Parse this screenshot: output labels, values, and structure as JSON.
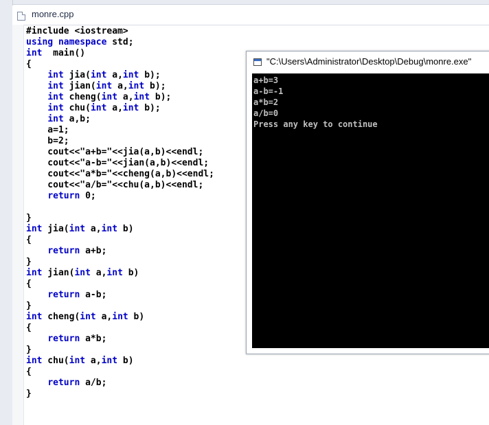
{
  "editor": {
    "file_name": "monre.cpp",
    "code_lines": [
      [
        {
          "t": "#include <iostream>",
          "k": false
        }
      ],
      [
        {
          "t": "using namespace",
          "k": true
        },
        {
          "t": " std;",
          "k": false
        }
      ],
      [
        {
          "t": "int",
          "k": true
        },
        {
          "t": "  main()",
          "k": false
        }
      ],
      [
        {
          "t": "{",
          "k": false
        }
      ],
      [
        {
          "t": "    ",
          "k": false
        },
        {
          "t": "int",
          "k": true
        },
        {
          "t": " jia(",
          "k": false
        },
        {
          "t": "int",
          "k": true
        },
        {
          "t": " a,",
          "k": false
        },
        {
          "t": "int",
          "k": true
        },
        {
          "t": " b);",
          "k": false
        }
      ],
      [
        {
          "t": "    ",
          "k": false
        },
        {
          "t": "int",
          "k": true
        },
        {
          "t": " jian(",
          "k": false
        },
        {
          "t": "int",
          "k": true
        },
        {
          "t": " a,",
          "k": false
        },
        {
          "t": "int",
          "k": true
        },
        {
          "t": " b);",
          "k": false
        }
      ],
      [
        {
          "t": "    ",
          "k": false
        },
        {
          "t": "int",
          "k": true
        },
        {
          "t": " cheng(",
          "k": false
        },
        {
          "t": "int",
          "k": true
        },
        {
          "t": " a,",
          "k": false
        },
        {
          "t": "int",
          "k": true
        },
        {
          "t": " b);",
          "k": false
        }
      ],
      [
        {
          "t": "    ",
          "k": false
        },
        {
          "t": "int",
          "k": true
        },
        {
          "t": " chu(",
          "k": false
        },
        {
          "t": "int",
          "k": true
        },
        {
          "t": " a,",
          "k": false
        },
        {
          "t": "int",
          "k": true
        },
        {
          "t": " b);",
          "k": false
        }
      ],
      [
        {
          "t": "    ",
          "k": false
        },
        {
          "t": "int",
          "k": true
        },
        {
          "t": " a,b;",
          "k": false
        }
      ],
      [
        {
          "t": "    a=1;",
          "k": false
        }
      ],
      [
        {
          "t": "    b=2;",
          "k": false
        }
      ],
      [
        {
          "t": "    cout<<\"a+b=\"<<jia(a,b)<<endl;",
          "k": false
        }
      ],
      [
        {
          "t": "    cout<<\"a-b=\"<<jian(a,b)<<endl;",
          "k": false
        }
      ],
      [
        {
          "t": "    cout<<\"a*b=\"<<cheng(a,b)<<endl;",
          "k": false
        }
      ],
      [
        {
          "t": "    cout<<\"a/b=\"<<chu(a,b)<<endl;",
          "k": false
        }
      ],
      [
        {
          "t": "    ",
          "k": false
        },
        {
          "t": "return",
          "k": true
        },
        {
          "t": " 0;",
          "k": false
        }
      ],
      [
        {
          "t": "",
          "k": false
        }
      ],
      [
        {
          "t": "}",
          "k": false
        }
      ],
      [
        {
          "t": "int",
          "k": true
        },
        {
          "t": " jia(",
          "k": false
        },
        {
          "t": "int",
          "k": true
        },
        {
          "t": " a,",
          "k": false
        },
        {
          "t": "int",
          "k": true
        },
        {
          "t": " b)",
          "k": false
        }
      ],
      [
        {
          "t": "{",
          "k": false
        }
      ],
      [
        {
          "t": "    ",
          "k": false
        },
        {
          "t": "return",
          "k": true
        },
        {
          "t": " a+b;",
          "k": false
        }
      ],
      [
        {
          "t": "}",
          "k": false
        }
      ],
      [
        {
          "t": "int",
          "k": true
        },
        {
          "t": " jian(",
          "k": false
        },
        {
          "t": "int",
          "k": true
        },
        {
          "t": " a,",
          "k": false
        },
        {
          "t": "int",
          "k": true
        },
        {
          "t": " b)",
          "k": false
        }
      ],
      [
        {
          "t": "{",
          "k": false
        }
      ],
      [
        {
          "t": "    ",
          "k": false
        },
        {
          "t": "return",
          "k": true
        },
        {
          "t": " a-b;",
          "k": false
        }
      ],
      [
        {
          "t": "}",
          "k": false
        }
      ],
      [
        {
          "t": "int",
          "k": true
        },
        {
          "t": " cheng(",
          "k": false
        },
        {
          "t": "int",
          "k": true
        },
        {
          "t": " a,",
          "k": false
        },
        {
          "t": "int",
          "k": true
        },
        {
          "t": " b)",
          "k": false
        }
      ],
      [
        {
          "t": "{",
          "k": false
        }
      ],
      [
        {
          "t": "    ",
          "k": false
        },
        {
          "t": "return",
          "k": true
        },
        {
          "t": " a*b;",
          "k": false
        }
      ],
      [
        {
          "t": "}",
          "k": false
        }
      ],
      [
        {
          "t": "int",
          "k": true
        },
        {
          "t": " chu(",
          "k": false
        },
        {
          "t": "int",
          "k": true
        },
        {
          "t": " a,",
          "k": false
        },
        {
          "t": "int",
          "k": true
        },
        {
          "t": " b)",
          "k": false
        }
      ],
      [
        {
          "t": "{",
          "k": false
        }
      ],
      [
        {
          "t": "    ",
          "k": false
        },
        {
          "t": "return",
          "k": true
        },
        {
          "t": " a/b;",
          "k": false
        }
      ],
      [
        {
          "t": "}",
          "k": false
        }
      ]
    ],
    "keyword_color": "#0000c8",
    "text_color": "#000000"
  },
  "console": {
    "title": "\"C:\\Users\\Administrator\\Desktop\\Debug\\monre.exe\"",
    "output_lines": [
      "a+b=3",
      "a-b=-1",
      "a*b=2",
      "a/b=0",
      "Press any key to continue"
    ],
    "background": "#000000",
    "text_color": "#c0c0c0"
  }
}
